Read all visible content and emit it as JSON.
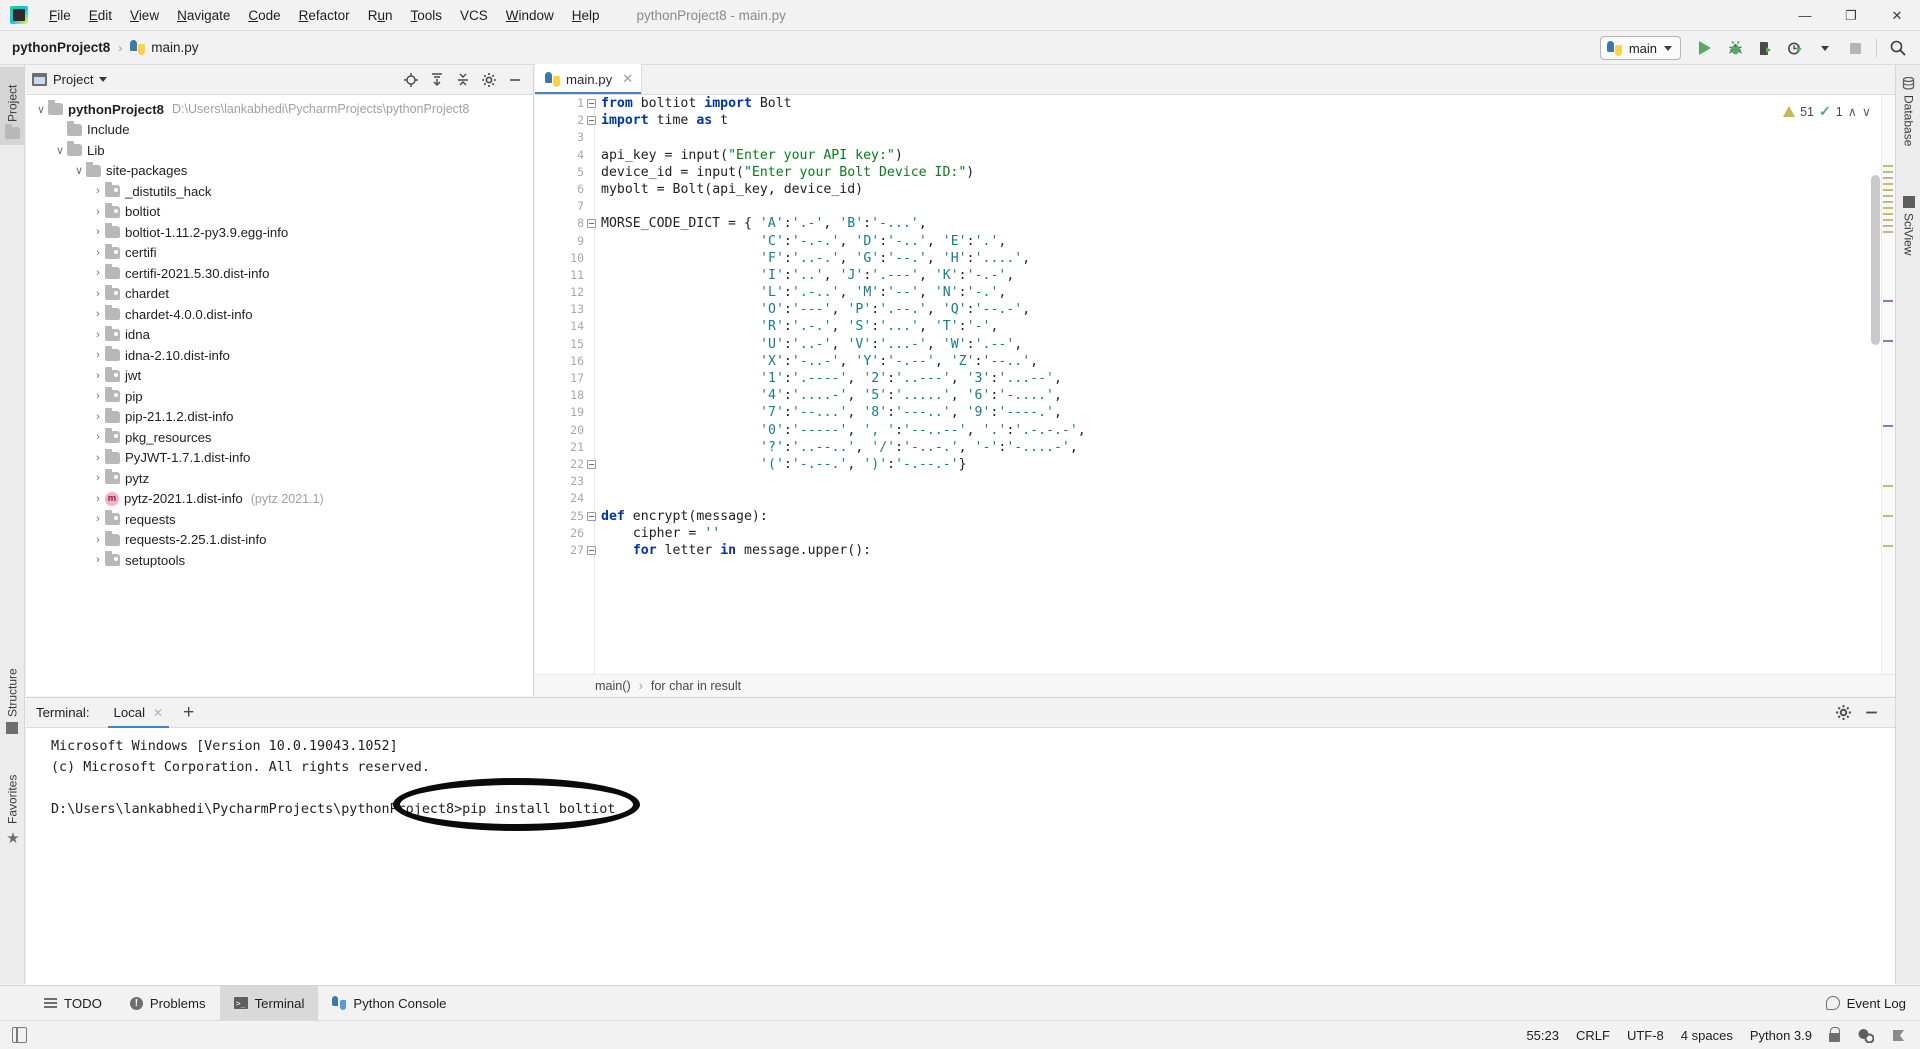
{
  "titlebar": {
    "logo_icon": "pycharm-logo-icon",
    "window_title": "pythonProject8 - main.py",
    "menus": [
      {
        "label": "File"
      },
      {
        "label": "Edit"
      },
      {
        "label": "View"
      },
      {
        "label": "Navigate"
      },
      {
        "label": "Code"
      },
      {
        "label": "Refactor"
      },
      {
        "label": "Run"
      },
      {
        "label": "Tools"
      },
      {
        "label": "VCS"
      },
      {
        "label": "Window"
      },
      {
        "label": "Help"
      }
    ],
    "minimize": "—",
    "maximize": "❐",
    "close": "✕"
  },
  "navbar": {
    "project_name": "pythonProject8",
    "separator": "›",
    "file_name": "main.py",
    "run_config": "main",
    "buttons": [
      {
        "name": "run-button",
        "glyph": ""
      },
      {
        "name": "debug-button",
        "glyph": ""
      },
      {
        "name": "run-coverage-button",
        "glyph": ""
      },
      {
        "name": "profile-button",
        "glyph": ""
      },
      {
        "name": "stop-button",
        "glyph": ""
      },
      {
        "name": "search-everywhere-button",
        "glyph": ""
      }
    ]
  },
  "left_strip": {
    "top_tabs": [
      {
        "label": "Project",
        "active": true
      }
    ],
    "bottom_tabs": [
      {
        "label": "Structure"
      },
      {
        "label": "Favorites"
      }
    ]
  },
  "right_strip": {
    "tabs": [
      {
        "label": "Database"
      },
      {
        "label": "SciView"
      }
    ]
  },
  "project_panel": {
    "title": "Project",
    "dropdown_glyph": "▾",
    "header_icons": [
      "locate-icon",
      "expand-all-icon",
      "collapse-all-icon",
      "gear-icon",
      "hide-icon"
    ],
    "tree": [
      {
        "depth": 0,
        "chev": "∨",
        "icon": "folder",
        "label": "pythonProject8",
        "bold": true,
        "path": "D:\\Users\\lankabhedi\\PycharmProjects\\pythonProject8"
      },
      {
        "depth": 1,
        "chev": "",
        "icon": "folder",
        "label": "Include"
      },
      {
        "depth": 1,
        "chev": "∨",
        "icon": "folder",
        "label": "Lib"
      },
      {
        "depth": 2,
        "chev": "∨",
        "icon": "folder",
        "label": "site-packages"
      },
      {
        "depth": 3,
        "chev": "›",
        "icon": "folder-src",
        "label": "_distutils_hack"
      },
      {
        "depth": 3,
        "chev": "›",
        "icon": "folder-src",
        "label": "boltiot"
      },
      {
        "depth": 3,
        "chev": "›",
        "icon": "folder",
        "label": "boltiot-1.11.2-py3.9.egg-info"
      },
      {
        "depth": 3,
        "chev": "›",
        "icon": "folder-src",
        "label": "certifi"
      },
      {
        "depth": 3,
        "chev": "›",
        "icon": "folder",
        "label": "certifi-2021.5.30.dist-info"
      },
      {
        "depth": 3,
        "chev": "›",
        "icon": "folder-src",
        "label": "chardet"
      },
      {
        "depth": 3,
        "chev": "›",
        "icon": "folder",
        "label": "chardet-4.0.0.dist-info"
      },
      {
        "depth": 3,
        "chev": "›",
        "icon": "folder-src",
        "label": "idna"
      },
      {
        "depth": 3,
        "chev": "›",
        "icon": "folder",
        "label": "idna-2.10.dist-info"
      },
      {
        "depth": 3,
        "chev": "›",
        "icon": "folder-src",
        "label": "jwt"
      },
      {
        "depth": 3,
        "chev": "›",
        "icon": "folder-src",
        "label": "pip"
      },
      {
        "depth": 3,
        "chev": "›",
        "icon": "folder",
        "label": "pip-21.1.2.dist-info"
      },
      {
        "depth": 3,
        "chev": "›",
        "icon": "folder-src",
        "label": "pkg_resources"
      },
      {
        "depth": 3,
        "chev": "›",
        "icon": "folder",
        "label": "PyJWT-1.7.1.dist-info"
      },
      {
        "depth": 3,
        "chev": "›",
        "icon": "folder-src",
        "label": "pytz"
      },
      {
        "depth": 3,
        "chev": "›",
        "icon": "module-badge",
        "label": "pytz-2021.1.dist-info",
        "dim": "(pytz 2021.1)"
      },
      {
        "depth": 3,
        "chev": "›",
        "icon": "folder-src",
        "label": "requests"
      },
      {
        "depth": 3,
        "chev": "›",
        "icon": "folder",
        "label": "requests-2.25.1.dist-info"
      },
      {
        "depth": 3,
        "chev": "›",
        "icon": "folder-src",
        "label": "setuptools"
      }
    ]
  },
  "editor": {
    "tab": {
      "label": "main.py",
      "icon": "python-file-icon",
      "close_glyph": "✕"
    },
    "inspection": {
      "warning_count": "51",
      "warning_icon": "warning-triangle-icon",
      "ok_count": "1",
      "ok_icon": "green-check-icon",
      "up_glyph": "∧",
      "down_glyph": "∨"
    },
    "breadcrumb": {
      "items": [
        "main()",
        "for char in result"
      ],
      "separator": "›"
    },
    "lines": [
      {
        "n": "1",
        "fold": true,
        "text": "from boltiot import Bolt"
      },
      {
        "n": "2",
        "fold": true,
        "text": "import time as t"
      },
      {
        "n": "3",
        "fold": false,
        "text": ""
      },
      {
        "n": "4",
        "fold": false,
        "text": "api_key = input(\"Enter your API key:\")"
      },
      {
        "n": "5",
        "fold": false,
        "text": "device_id = input(\"Enter your Bolt Device ID:\")"
      },
      {
        "n": "6",
        "fold": false,
        "text": "mybolt = Bolt(api_key, device_id)"
      },
      {
        "n": "7",
        "fold": false,
        "text": ""
      },
      {
        "n": "8",
        "fold": true,
        "text": "MORSE_CODE_DICT = { 'A':'.-', 'B':'-...',"
      },
      {
        "n": "9",
        "fold": false,
        "text": "                    'C':'-.-.', 'D':'-..', 'E':'.',"
      },
      {
        "n": "10",
        "fold": false,
        "text": "                    'F':'..-.', 'G':'--.', 'H':'....',"
      },
      {
        "n": "11",
        "fold": false,
        "text": "                    'I':'..', 'J':'.---', 'K':'-.-',"
      },
      {
        "n": "12",
        "fold": false,
        "text": "                    'L':'.-..', 'M':'--', 'N':'-.',"
      },
      {
        "n": "13",
        "fold": false,
        "text": "                    'O':'---', 'P':'.--.', 'Q':'--.-',"
      },
      {
        "n": "14",
        "fold": false,
        "text": "                    'R':'.-.', 'S':'...', 'T':'-',"
      },
      {
        "n": "15",
        "fold": false,
        "text": "                    'U':'..-', 'V':'...-', 'W':'.--',"
      },
      {
        "n": "16",
        "fold": false,
        "text": "                    'X':'-..-', 'Y':'-.--', 'Z':'--..',"
      },
      {
        "n": "17",
        "fold": false,
        "text": "                    '1':'.----', '2':'..---', '3':'...--',"
      },
      {
        "n": "18",
        "fold": false,
        "text": "                    '4':'....-', '5':'.....', '6':'-....',"
      },
      {
        "n": "19",
        "fold": false,
        "text": "                    '7':'--...', '8':'---..', '9':'----.',"
      },
      {
        "n": "20",
        "fold": false,
        "text": "                    '0':'-----', ', ':'--..--', '.':'.-.-.-',"
      },
      {
        "n": "21",
        "fold": false,
        "text": "                    '?':'..--..', '/':'-..-.', '-':'-....-',"
      },
      {
        "n": "22",
        "fold": true,
        "text": "                    '(':'-.--.', ')':'-.--.-'}"
      },
      {
        "n": "23",
        "fold": false,
        "text": ""
      },
      {
        "n": "24",
        "fold": false,
        "text": ""
      },
      {
        "n": "25",
        "fold": true,
        "text": "def encrypt(message):"
      },
      {
        "n": "26",
        "fold": false,
        "text": "    cipher = ''"
      },
      {
        "n": "27",
        "fold": true,
        "text": "    for letter in message.upper():"
      }
    ]
  },
  "terminal": {
    "label": "Terminal:",
    "tab": {
      "label": "Local",
      "close_glyph": "✕"
    },
    "add_glyph": "+",
    "header_icons": [
      "gear-icon",
      "hide-icon"
    ],
    "lines": [
      "Microsoft Windows [Version 10.0.19043.1052]",
      "(c) Microsoft Corporation. All rights reserved.",
      "",
      "D:\\Users\\lankabhedi\\PycharmProjects\\pythonProject8>pip install boltiot"
    ],
    "annotation": "black-ellipse-highlight"
  },
  "bottom_tool_tabs": [
    {
      "label": "TODO",
      "icon": "todo-icon",
      "active": false
    },
    {
      "label": "Problems",
      "icon": "problems-icon",
      "active": false
    },
    {
      "label": "Terminal",
      "icon": "terminal-icon",
      "active": true
    },
    {
      "label": "Python Console",
      "icon": "python-console-icon",
      "active": false
    }
  ],
  "event_log": {
    "label": "Event Log",
    "icon": "event-log-icon"
  },
  "statusbar": {
    "left_icon": "reader-mode-icon",
    "caret_position": "55:23",
    "line_separator": "CRLF",
    "encoding": "UTF-8",
    "indent": "4 spaces",
    "interpreter": "Python 3.9",
    "icons": [
      "lock-icon",
      "inspection-gear-icon",
      "ide-flag-icon"
    ]
  },
  "colors": {
    "accent_blue": "#4083c9",
    "green_run": "#59a869",
    "keyword_blue": "#0033b3",
    "string_green": "#067d17",
    "dict_teal": "#138086",
    "chrome_bg": "#f2f2f2"
  }
}
